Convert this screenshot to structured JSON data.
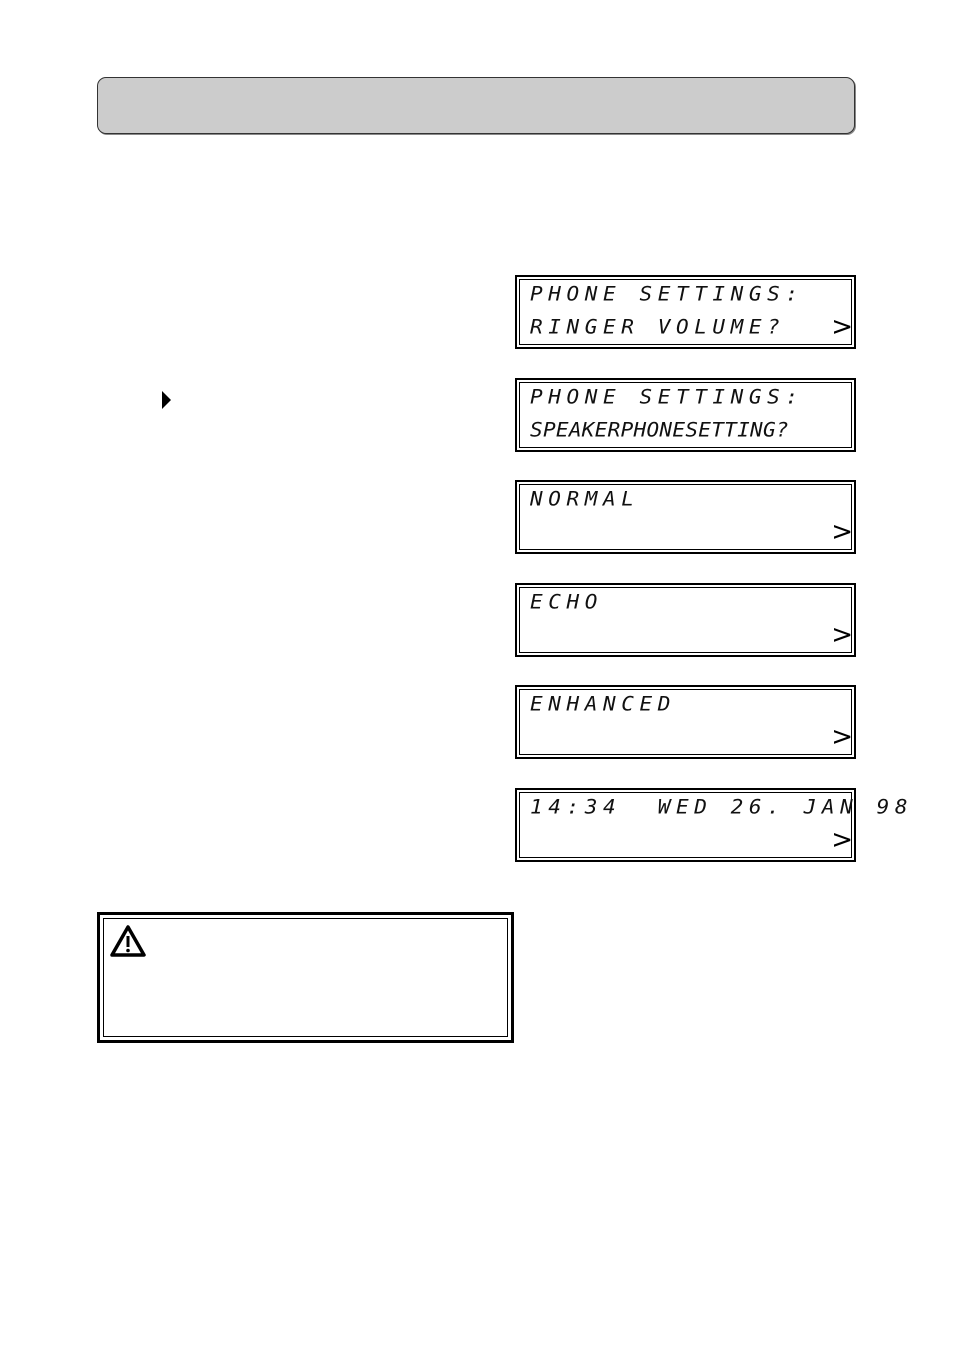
{
  "header": {
    "title": ""
  },
  "step_pointer": {
    "icon": "right-pointer-triangle-icon"
  },
  "displays": [
    {
      "line1": "PHONE SETTINGS:",
      "line2": "RINGER VOLUME?",
      "arrow": ">"
    },
    {
      "line1": "PHONE SETTINGS:",
      "line2": "SPEAKERPHONESETTING?",
      "arrow": ""
    },
    {
      "line1": "NORMAL",
      "line2": "",
      "arrow": ">"
    },
    {
      "line1": "ECHO",
      "line2": "",
      "arrow": ">"
    },
    {
      "line1": "ENHANCED",
      "line2": "",
      "arrow": ">"
    },
    {
      "line1": "14:34  WED 26. JAN 98",
      "line2": "",
      "arrow": ">"
    }
  ],
  "warning": {
    "icon": "warning-triangle-icon",
    "text": ""
  }
}
